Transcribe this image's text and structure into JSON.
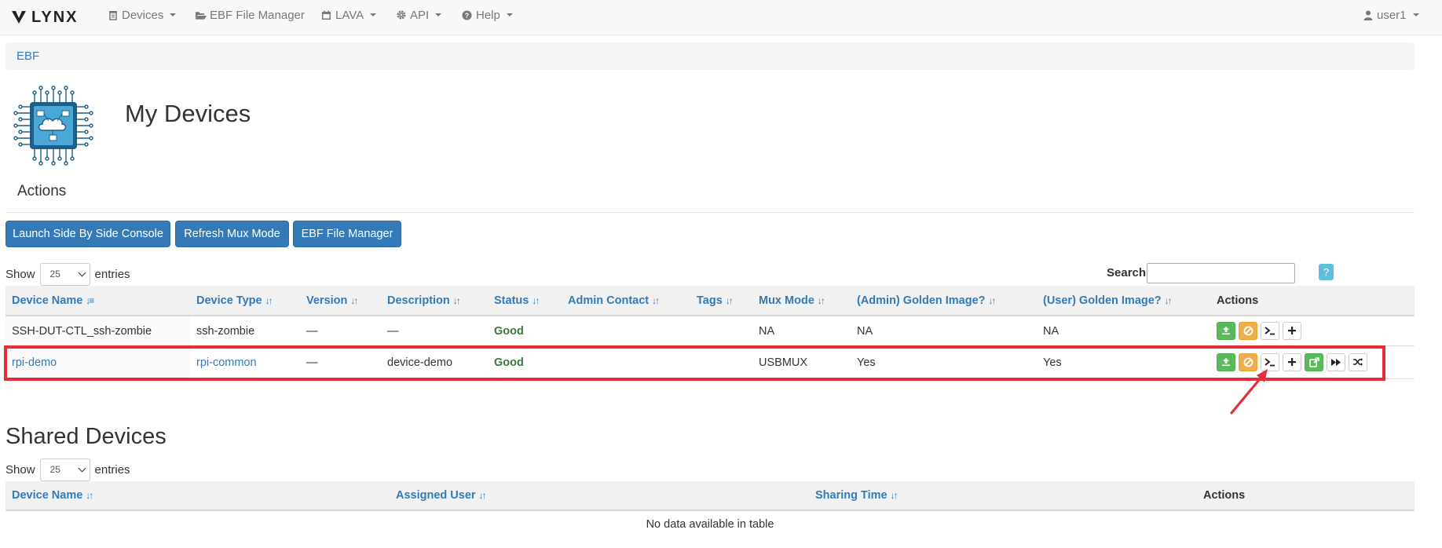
{
  "nav": {
    "brand": "LYNX",
    "items": [
      {
        "label": "Devices",
        "icon": "trash-icon"
      },
      {
        "label": "EBF File Manager",
        "icon": "folder-open-icon"
      },
      {
        "label": "LAVA",
        "icon": "calendar-icon"
      },
      {
        "label": "API",
        "icon": "gear-icon"
      },
      {
        "label": "Help",
        "icon": "question-circle-icon"
      }
    ],
    "user": "user1"
  },
  "breadcrumb": {
    "item": "EBF"
  },
  "page": {
    "title": "My Devices",
    "actions_heading": "Actions",
    "buttons": {
      "side_by_side": "Launch Side By Side Console",
      "refresh_mux": "Refresh Mux Mode",
      "file_manager": "EBF File Manager"
    }
  },
  "my_devices_table": {
    "show_label": "Show",
    "entries_label": "entries",
    "page_size": "25",
    "search_label": "Search",
    "help_label": "?",
    "columns": [
      "Device Name",
      "Device Type",
      "Version",
      "Description",
      "Status",
      "Admin Contact",
      "Tags",
      "Mux Mode",
      "(Admin) Golden Image?",
      "(User) Golden Image?",
      "Actions"
    ],
    "rows": [
      {
        "device_name": "SSH-DUT-CTL_ssh-zombie",
        "device_type": "ssh-zombie",
        "version": "—",
        "description": "—",
        "status": "Good",
        "admin_contact": "",
        "tags": "",
        "mux_mode": "NA",
        "admin_golden": "NA",
        "user_golden": "NA"
      },
      {
        "device_name": "rpi-demo",
        "device_type": "rpi-common",
        "version": "—",
        "description": "device-demo",
        "status": "Good",
        "admin_contact": "",
        "tags": "",
        "mux_mode": "USBMUX",
        "admin_golden": "Yes",
        "user_golden": "Yes"
      }
    ]
  },
  "shared_devices": {
    "title": "Shared Devices",
    "show_label": "Show",
    "entries_label": "entries",
    "page_size": "25",
    "columns": [
      "Device Name",
      "Assigned User",
      "Sharing Time",
      "Actions"
    ],
    "empty_message": "No data available in table"
  },
  "colors": {
    "primary": "#337ab7",
    "success": "#5cb85c",
    "warning": "#f0ad4e",
    "info": "#5bc0de",
    "highlight": "#e52e3a",
    "status_good": "#3c763d"
  }
}
